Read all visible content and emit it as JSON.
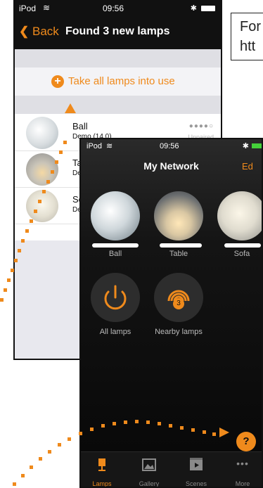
{
  "callout": {
    "line1": "For",
    "line2": "htt"
  },
  "screen1": {
    "status": {
      "device": "iPod",
      "time": "09:56"
    },
    "nav": {
      "back_label": "Back",
      "title": "Found 3 new lamps"
    },
    "take_all_label": "Take all lamps into use",
    "lamps": [
      {
        "name": "Ball",
        "subtitle": "Demo (14.0)",
        "status": "Unpaired"
      },
      {
        "name": "Ta",
        "subtitle": "De"
      },
      {
        "name": "So",
        "subtitle": "De"
      }
    ]
  },
  "screen2": {
    "status": {
      "device": "iPod",
      "time": "09:56"
    },
    "nav": {
      "title": "My Network",
      "edit_label": "Ed"
    },
    "lamps": [
      {
        "label": "Ball"
      },
      {
        "label": "Table"
      },
      {
        "label": "Sofa"
      }
    ],
    "actions": {
      "all_lamps": "All lamps",
      "nearby_lamps": "Nearby lamps",
      "nearby_count": "3"
    },
    "help_label": "?",
    "tabs": [
      {
        "label": "Lamps",
        "icon": "lamp-icon"
      },
      {
        "label": "Gallery",
        "icon": "gallery-icon"
      },
      {
        "label": "Scenes",
        "icon": "scenes-icon"
      },
      {
        "label": "More",
        "icon": "more-icon"
      }
    ]
  },
  "colors": {
    "accent": "#ef8a1c",
    "dark": "#111111"
  }
}
